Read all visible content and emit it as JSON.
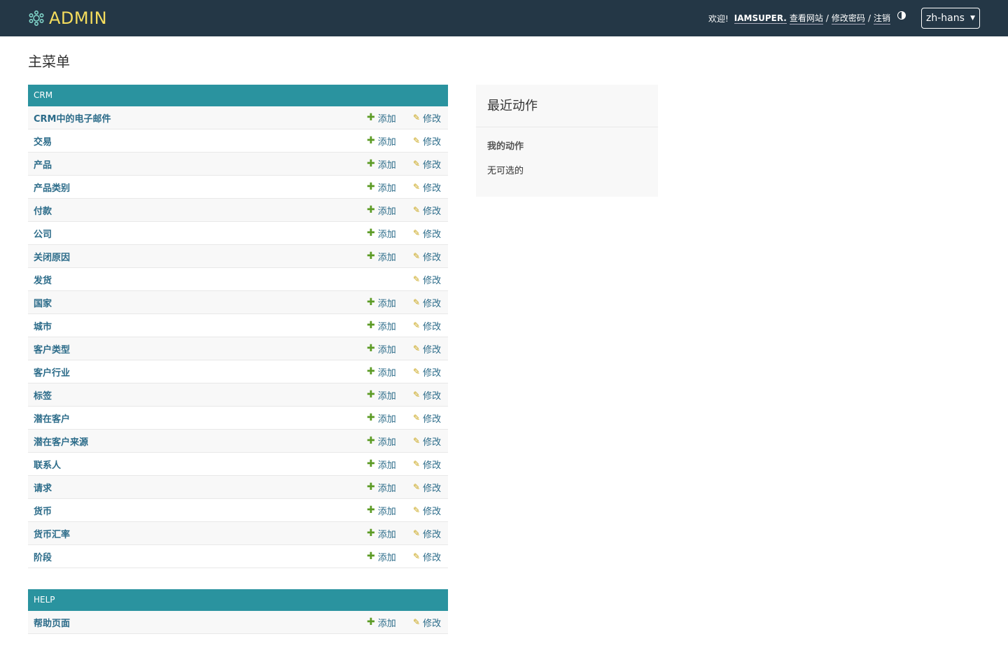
{
  "header": {
    "brand": "ADMIN",
    "welcome": "欢迎!",
    "username": "IAMSUPER.",
    "links": [
      "查看网站",
      "修改密码",
      "注销"
    ],
    "language": "zh-hans"
  },
  "page_title": "主菜单",
  "modules": [
    {
      "title": "CRM",
      "rows": [
        {
          "name": "CRM中的电子邮件",
          "add": "添加",
          "change": "修改"
        },
        {
          "name": "交易",
          "add": "添加",
          "change": "修改"
        },
        {
          "name": "产品",
          "add": "添加",
          "change": "修改"
        },
        {
          "name": "产品类别",
          "add": "添加",
          "change": "修改"
        },
        {
          "name": "付款",
          "add": "添加",
          "change": "修改"
        },
        {
          "name": "公司",
          "add": "添加",
          "change": "修改"
        },
        {
          "name": "关闭原因",
          "add": "添加",
          "change": "修改"
        },
        {
          "name": "发货",
          "add": "",
          "change": "修改"
        },
        {
          "name": "国家",
          "add": "添加",
          "change": "修改"
        },
        {
          "name": "城市",
          "add": "添加",
          "change": "修改"
        },
        {
          "name": "客户类型",
          "add": "添加",
          "change": "修改"
        },
        {
          "name": "客户行业",
          "add": "添加",
          "change": "修改"
        },
        {
          "name": "标签",
          "add": "添加",
          "change": "修改"
        },
        {
          "name": "潜在客户",
          "add": "添加",
          "change": "修改"
        },
        {
          "name": "潜在客户来源",
          "add": "添加",
          "change": "修改"
        },
        {
          "name": "联系人",
          "add": "添加",
          "change": "修改"
        },
        {
          "name": "请求",
          "add": "添加",
          "change": "修改"
        },
        {
          "name": "货币",
          "add": "添加",
          "change": "修改"
        },
        {
          "name": "货币汇率",
          "add": "添加",
          "change": "修改"
        },
        {
          "name": "阶段",
          "add": "添加",
          "change": "修改"
        }
      ]
    },
    {
      "title": "HELP",
      "rows": [
        {
          "name": "帮助页面",
          "add": "添加",
          "change": "修改"
        }
      ]
    }
  ],
  "sidebar": {
    "title": "最近动作",
    "subtitle": "我的动作",
    "empty": "无可选的"
  },
  "colors": {
    "header_bg": "#243746",
    "brand": "#f5dd5d",
    "module_header": "#2a939f",
    "link": "#2b6b89",
    "add_icon": "#5c9b25",
    "change_icon": "#c8a415"
  },
  "icons": {
    "logo": "gear-logo-icon",
    "theme": "theme-toggle-icon",
    "add": "plus-icon",
    "change": "pencil-icon"
  }
}
